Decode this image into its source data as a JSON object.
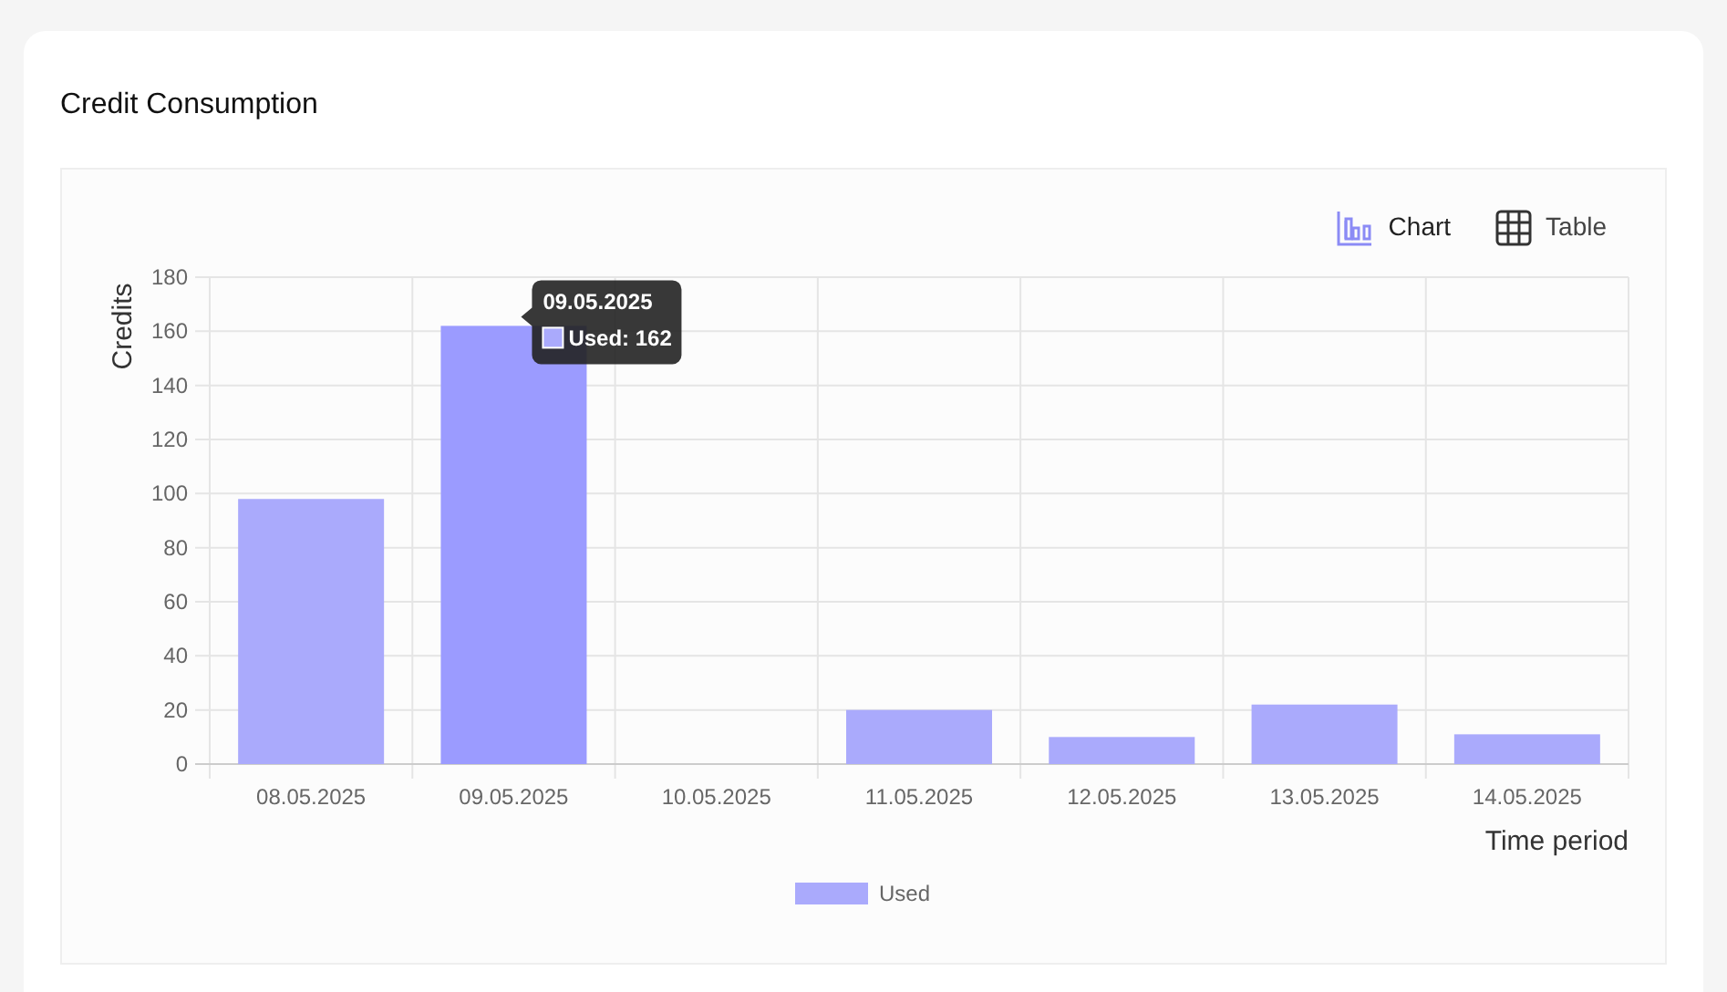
{
  "card": {
    "title": "Credit Consumption"
  },
  "view_toggle": [
    {
      "kind": "chart",
      "label": "Chart",
      "selected": true
    },
    {
      "kind": "table",
      "label": "Table",
      "selected": false
    }
  ],
  "chart_data": {
    "type": "bar",
    "xlabel": "Time period",
    "ylabel": "Credits",
    "categories": [
      "08.05.2025",
      "09.05.2025",
      "10.05.2025",
      "11.05.2025",
      "12.05.2025",
      "13.05.2025",
      "14.05.2025"
    ],
    "series": [
      {
        "name": "Used",
        "color": "#aaaafc",
        "values": [
          98,
          162,
          0,
          20,
          10,
          22,
          11
        ]
      }
    ],
    "grid": true,
    "ylim": [
      0,
      180
    ],
    "yticks": [
      0,
      20,
      40,
      60,
      80,
      100,
      120,
      140,
      160,
      180
    ]
  },
  "tooltip": {
    "title": "09.05.2025",
    "text": "Used: 162"
  }
}
